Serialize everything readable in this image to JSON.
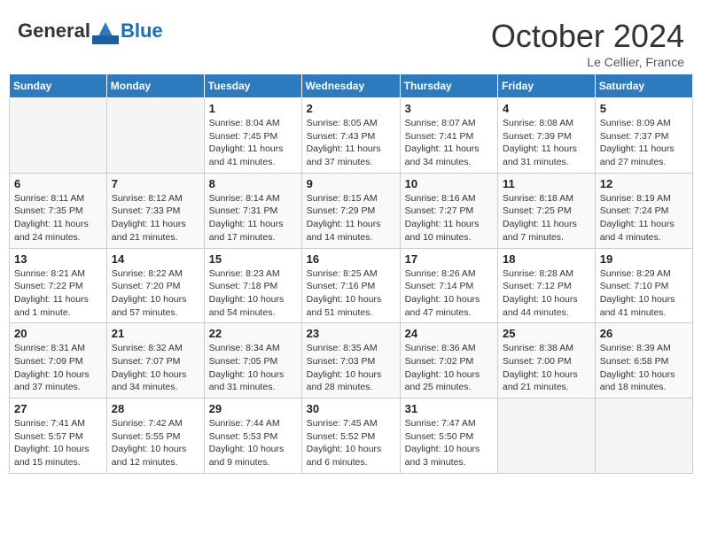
{
  "header": {
    "logo_general": "General",
    "logo_blue": "Blue",
    "month": "October 2024",
    "location": "Le Cellier, France"
  },
  "days_of_week": [
    "Sunday",
    "Monday",
    "Tuesday",
    "Wednesday",
    "Thursday",
    "Friday",
    "Saturday"
  ],
  "weeks": [
    [
      {
        "day": "",
        "info": ""
      },
      {
        "day": "",
        "info": ""
      },
      {
        "day": "1",
        "info": "Sunrise: 8:04 AM\nSunset: 7:45 PM\nDaylight: 11 hours and 41 minutes."
      },
      {
        "day": "2",
        "info": "Sunrise: 8:05 AM\nSunset: 7:43 PM\nDaylight: 11 hours and 37 minutes."
      },
      {
        "day": "3",
        "info": "Sunrise: 8:07 AM\nSunset: 7:41 PM\nDaylight: 11 hours and 34 minutes."
      },
      {
        "day": "4",
        "info": "Sunrise: 8:08 AM\nSunset: 7:39 PM\nDaylight: 11 hours and 31 minutes."
      },
      {
        "day": "5",
        "info": "Sunrise: 8:09 AM\nSunset: 7:37 PM\nDaylight: 11 hours and 27 minutes."
      }
    ],
    [
      {
        "day": "6",
        "info": "Sunrise: 8:11 AM\nSunset: 7:35 PM\nDaylight: 11 hours and 24 minutes."
      },
      {
        "day": "7",
        "info": "Sunrise: 8:12 AM\nSunset: 7:33 PM\nDaylight: 11 hours and 21 minutes."
      },
      {
        "day": "8",
        "info": "Sunrise: 8:14 AM\nSunset: 7:31 PM\nDaylight: 11 hours and 17 minutes."
      },
      {
        "day": "9",
        "info": "Sunrise: 8:15 AM\nSunset: 7:29 PM\nDaylight: 11 hours and 14 minutes."
      },
      {
        "day": "10",
        "info": "Sunrise: 8:16 AM\nSunset: 7:27 PM\nDaylight: 11 hours and 10 minutes."
      },
      {
        "day": "11",
        "info": "Sunrise: 8:18 AM\nSunset: 7:25 PM\nDaylight: 11 hours and 7 minutes."
      },
      {
        "day": "12",
        "info": "Sunrise: 8:19 AM\nSunset: 7:24 PM\nDaylight: 11 hours and 4 minutes."
      }
    ],
    [
      {
        "day": "13",
        "info": "Sunrise: 8:21 AM\nSunset: 7:22 PM\nDaylight: 11 hours and 1 minute."
      },
      {
        "day": "14",
        "info": "Sunrise: 8:22 AM\nSunset: 7:20 PM\nDaylight: 10 hours and 57 minutes."
      },
      {
        "day": "15",
        "info": "Sunrise: 8:23 AM\nSunset: 7:18 PM\nDaylight: 10 hours and 54 minutes."
      },
      {
        "day": "16",
        "info": "Sunrise: 8:25 AM\nSunset: 7:16 PM\nDaylight: 10 hours and 51 minutes."
      },
      {
        "day": "17",
        "info": "Sunrise: 8:26 AM\nSunset: 7:14 PM\nDaylight: 10 hours and 47 minutes."
      },
      {
        "day": "18",
        "info": "Sunrise: 8:28 AM\nSunset: 7:12 PM\nDaylight: 10 hours and 44 minutes."
      },
      {
        "day": "19",
        "info": "Sunrise: 8:29 AM\nSunset: 7:10 PM\nDaylight: 10 hours and 41 minutes."
      }
    ],
    [
      {
        "day": "20",
        "info": "Sunrise: 8:31 AM\nSunset: 7:09 PM\nDaylight: 10 hours and 37 minutes."
      },
      {
        "day": "21",
        "info": "Sunrise: 8:32 AM\nSunset: 7:07 PM\nDaylight: 10 hours and 34 minutes."
      },
      {
        "day": "22",
        "info": "Sunrise: 8:34 AM\nSunset: 7:05 PM\nDaylight: 10 hours and 31 minutes."
      },
      {
        "day": "23",
        "info": "Sunrise: 8:35 AM\nSunset: 7:03 PM\nDaylight: 10 hours and 28 minutes."
      },
      {
        "day": "24",
        "info": "Sunrise: 8:36 AM\nSunset: 7:02 PM\nDaylight: 10 hours and 25 minutes."
      },
      {
        "day": "25",
        "info": "Sunrise: 8:38 AM\nSunset: 7:00 PM\nDaylight: 10 hours and 21 minutes."
      },
      {
        "day": "26",
        "info": "Sunrise: 8:39 AM\nSunset: 6:58 PM\nDaylight: 10 hours and 18 minutes."
      }
    ],
    [
      {
        "day": "27",
        "info": "Sunrise: 7:41 AM\nSunset: 5:57 PM\nDaylight: 10 hours and 15 minutes."
      },
      {
        "day": "28",
        "info": "Sunrise: 7:42 AM\nSunset: 5:55 PM\nDaylight: 10 hours and 12 minutes."
      },
      {
        "day": "29",
        "info": "Sunrise: 7:44 AM\nSunset: 5:53 PM\nDaylight: 10 hours and 9 minutes."
      },
      {
        "day": "30",
        "info": "Sunrise: 7:45 AM\nSunset: 5:52 PM\nDaylight: 10 hours and 6 minutes."
      },
      {
        "day": "31",
        "info": "Sunrise: 7:47 AM\nSunset: 5:50 PM\nDaylight: 10 hours and 3 minutes."
      },
      {
        "day": "",
        "info": ""
      },
      {
        "day": "",
        "info": ""
      }
    ]
  ]
}
